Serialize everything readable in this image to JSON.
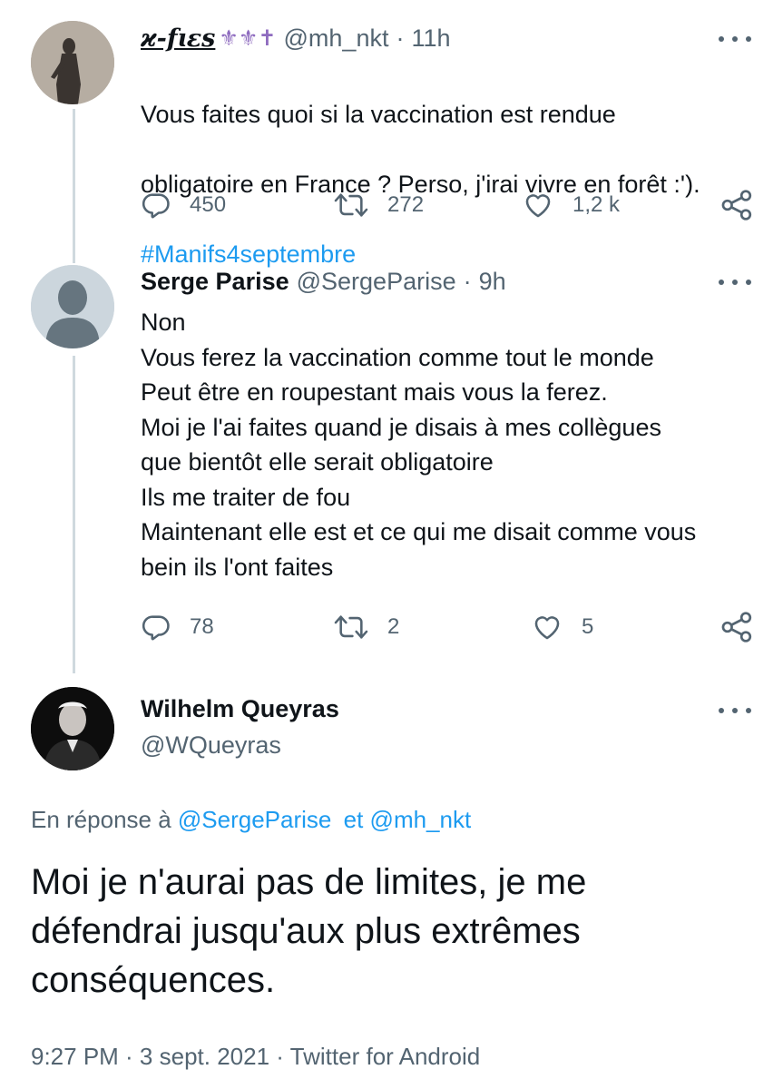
{
  "tweets": [
    {
      "display_name": "ϰ-fɩɛs",
      "name_emoji": "⚜⚜✝",
      "handle": "@mh_nkt",
      "time": "11h",
      "text_line1": "Vous faites quoi si la vaccination est rendue",
      "text_line2": "obligatoire en France ? Perso, j'irai vivre en forêt :').",
      "hashtag": "#Manifs4septembre",
      "replies": "450",
      "retweets": "272",
      "likes": "1,2 k"
    },
    {
      "display_name": "Serge Parise",
      "handle": "@SergeParise",
      "time": "9h",
      "text": "Non\nVous ferez la vaccination comme tout le monde\nPeut être en roupestant mais vous la ferez.\nMoi je l'ai faites quand je disais à mes collègues\nque bientôt elle serait obligatoire\nIls me traiter de fou\nMaintenant elle est et ce qui me disait comme vous\nbein ils l'ont faites",
      "replies": "78",
      "retweets": "2",
      "likes": "5"
    }
  ],
  "main_tweet": {
    "display_name": "Wilhelm Queyras",
    "handle": "@WQueyras",
    "reply_prefix": "En réponse à",
    "reply_to_1": "@SergeParise",
    "reply_conjunction": "et",
    "reply_to_2": "@mh_nkt",
    "text": "Moi je n'aurai pas de limites, je me\ndéfendrai jusqu'aux plus extrêmes\nconséquences.",
    "timestamp": "9:27 PM · 3 sept. 2021 · Twitter for Android"
  },
  "colors": {
    "text": "#0f1419",
    "secondary": "#536471",
    "link": "#1d9bf0",
    "thread_line": "#cfd9de",
    "emoji_purple": "#8e6bbf"
  }
}
